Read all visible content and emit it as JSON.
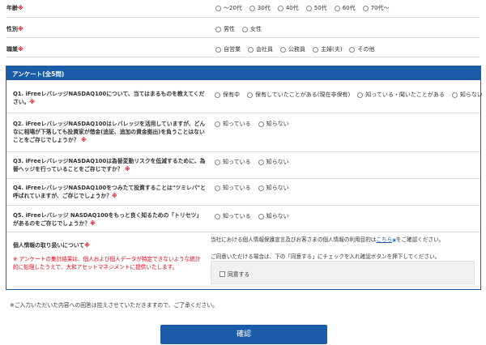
{
  "profile": {
    "age": {
      "label": "年齢",
      "required": "※",
      "options": [
        "〜20代",
        "30代",
        "40代",
        "50代",
        "60代",
        "70代〜"
      ]
    },
    "gender": {
      "label": "性別",
      "required": "※",
      "options": [
        "男性",
        "女性"
      ]
    },
    "occupation": {
      "label": "職業",
      "required": "※",
      "options": [
        "自営業",
        "会社員",
        "公務員",
        "主婦(夫)",
        "その他"
      ]
    }
  },
  "survey": {
    "title": "アンケート(全5問)",
    "questions": [
      {
        "text": "Q1. iFreeレバレッジNASDAQ100について、当てはまるものを教えてください。",
        "required": "※",
        "options": [
          "保有中",
          "保有していたことがある(現在非保有)",
          "知っている・聞いたことがある",
          "知らない"
        ]
      },
      {
        "text": "Q2. iFreeレバレッジNASDAQ100はレバレッジを活用していますが、どんなに相場が下落しても投資家が借金(追証、追加の資金拠出)を負うことはないことをご存じでしょうか？",
        "required": "※",
        "options": [
          "知っている",
          "知らない"
        ]
      },
      {
        "text": "Q3. iFreeレバレッジNASDAQ100は為替変動リスクを低減するために、為替ヘッジを行っていることをご存じですか？",
        "required": "※",
        "options": [
          "知っている",
          "知らない"
        ]
      },
      {
        "text": "Q4. iFreeレバレッジNASDAQ100をつみたて投資することは\"ツミレバ\"と呼ばれていますが、ご存じでしょうか？",
        "required": "※",
        "options": [
          "知っている",
          "知らない"
        ]
      },
      {
        "text": "Q5. iFreeレバレッジ NASDAQ100をもっと良く知るための「トリセツ」があるのをご存じでしょうか？",
        "required": "※",
        "options": [
          "知っている",
          "知らない"
        ]
      }
    ],
    "privacy": {
      "label": "個人情報の取り扱いについて",
      "required": "※",
      "note": "※ アンケートの集計結果は、個人および個人データが特定できないような統計的に処理したうえで、大和アセットマネジメントに提供いたします。",
      "text_before_link": "当社における個人情報保護宣言及びお客さまの個人情報の利用目的は",
      "link_text": "こちら",
      "text_after_link": "をご確認ください。",
      "instruction": "ご同意いただける場合は、下の「同意する」にチェックを入れ確認ボタンを押下してください。",
      "agree_label": "同意する"
    }
  },
  "footer_note": "※ご入力いただいた内容への回答は控えさせていただきますので、ご了承ください。",
  "confirm_label": "確認",
  "colors": {
    "primary": "#1a5ca8",
    "required": "#e60012"
  }
}
